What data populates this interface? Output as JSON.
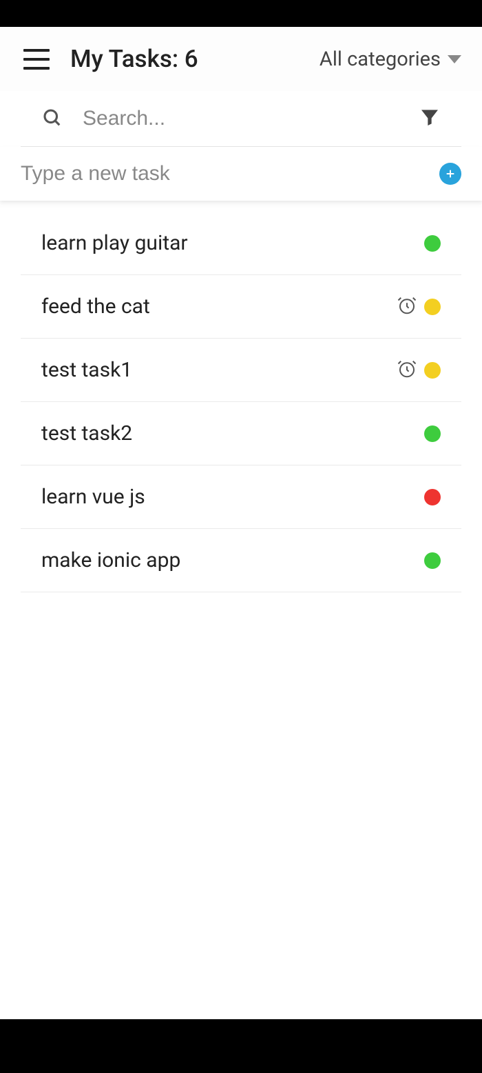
{
  "header": {
    "title": "My Tasks: 6",
    "category_label": "All categories"
  },
  "search": {
    "placeholder": "Search..."
  },
  "new_task": {
    "placeholder": "Type a new task"
  },
  "tasks": [
    {
      "title": "learn play guitar",
      "has_alarm": false,
      "color": "green"
    },
    {
      "title": "feed the cat",
      "has_alarm": true,
      "color": "yellow"
    },
    {
      "title": "test task1",
      "has_alarm": true,
      "color": "yellow"
    },
    {
      "title": "test task2",
      "has_alarm": false,
      "color": "green"
    },
    {
      "title": "learn vue js",
      "has_alarm": false,
      "color": "red"
    },
    {
      "title": "make ionic app",
      "has_alarm": false,
      "color": "green"
    }
  ]
}
